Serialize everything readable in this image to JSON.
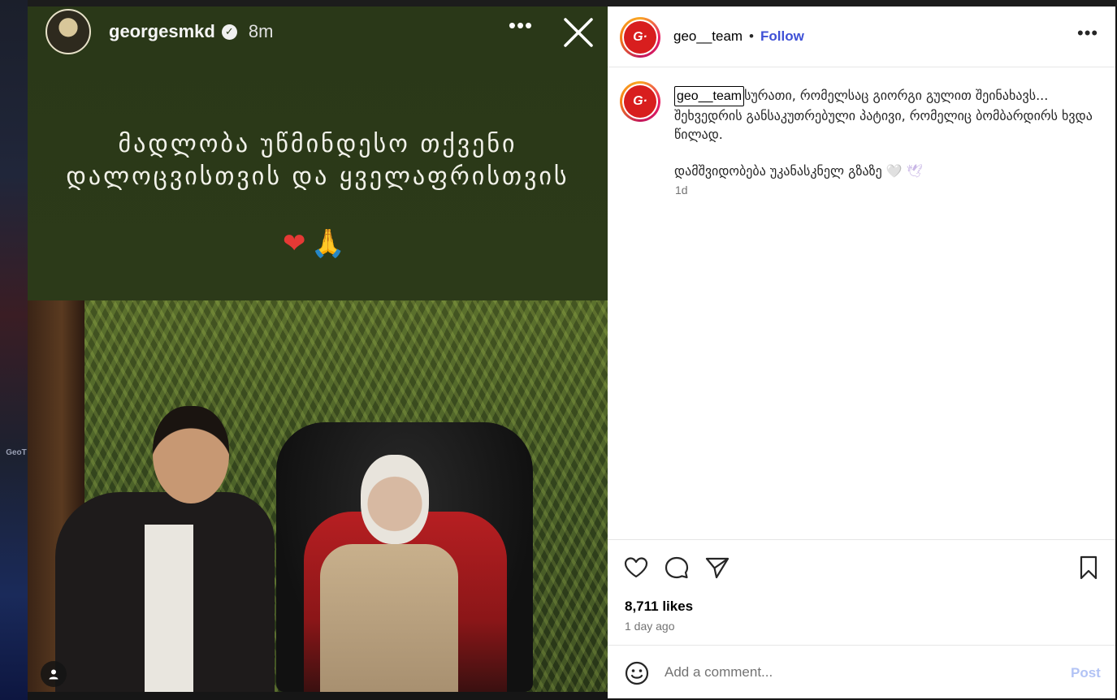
{
  "story": {
    "username": "georgesmkd",
    "verified_icon": "verified-badge-icon",
    "time": "8m",
    "more_icon": "•••",
    "text_line1": "მადლობა უწმინდესო თქვენი",
    "text_line2": "დალოცვისთვის და ყველაფრისთვის",
    "emoji_heart": "❤",
    "emoji_pray": "🙏"
  },
  "post": {
    "username": "geo__team",
    "separator": "•",
    "follow_label": "Follow",
    "more_icon": "•••",
    "logo_text": "G·",
    "caption_user": "geo__team",
    "caption_text": "სურათი, რომელსაც გიორგი გულით შეინახავს... შეხვედრის განსაკუთრებული პატივი, რომელიც ბომბარდირს ხვდა წილად.",
    "caption_line2": "დამშვიდობება უკანასკნელ გზაზე",
    "caption_emojis": "🤍 🕊",
    "caption_time": "1d",
    "likes": "8,711 likes",
    "date": "1 day ago",
    "comment_placeholder": "Add a comment...",
    "post_label": "Post"
  },
  "background": {
    "logo_text": "GeoT"
  },
  "colors": {
    "follow": "#3f51d6",
    "post_disabled": "#b2c3f5",
    "story_bg": "#2b3a1a",
    "logo_red": "#d81e1e"
  }
}
